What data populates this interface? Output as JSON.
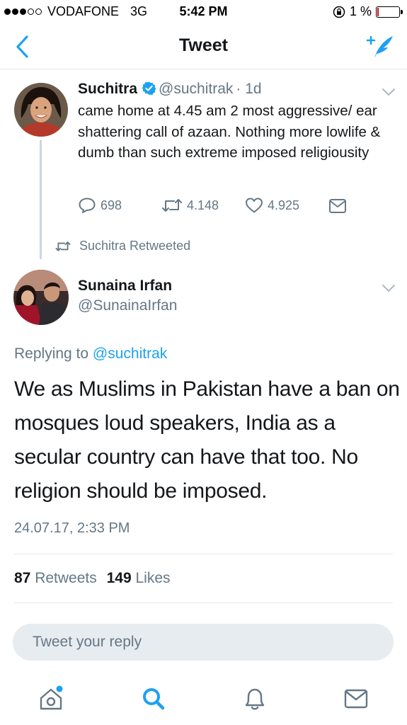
{
  "status_bar": {
    "carrier": "VODAFONE",
    "network": "3G",
    "time": "5:42 PM",
    "battery": "1 %",
    "battery_level": 0.01
  },
  "nav": {
    "title": "Tweet",
    "back_icon": "chevron-left-icon",
    "compose_icon": "compose-tweet-icon"
  },
  "quoted_tweet": {
    "name": "Suchitra",
    "handle": "@suchitrak",
    "time": "· 1d",
    "text": "came home at 4.45 am 2 most aggressive/ ear shattering call of azaan. Nothing more lowlife & dumb than such extreme imposed religiousity",
    "replies": "698",
    "retweets": "4.148",
    "likes": "4.925"
  },
  "retweet_label": "Suchitra Retweeted",
  "tweet": {
    "name": "Sunaina Irfan",
    "handle": "@SunainaIrfan",
    "replying_prefix": "Replying to",
    "replying_to": "@suchitrak",
    "text": "We as Muslims in Pakistan have a ban on mosques loud speakers, India as a secular country can have that too. No religion should be imposed.",
    "timestamp": "24.07.17, 2:33 PM",
    "retweet_count": "87",
    "retweet_label": "Retweets",
    "like_count": "149",
    "like_label": "Likes"
  },
  "reply": {
    "placeholder": "Tweet your reply"
  },
  "tabs": [
    "home-icon",
    "search-icon",
    "notifications-icon",
    "messages-icon"
  ],
  "colors": {
    "accent": "#1da1f2",
    "muted": "#657786",
    "text": "#14171a",
    "separator": "#e1e8ed"
  }
}
